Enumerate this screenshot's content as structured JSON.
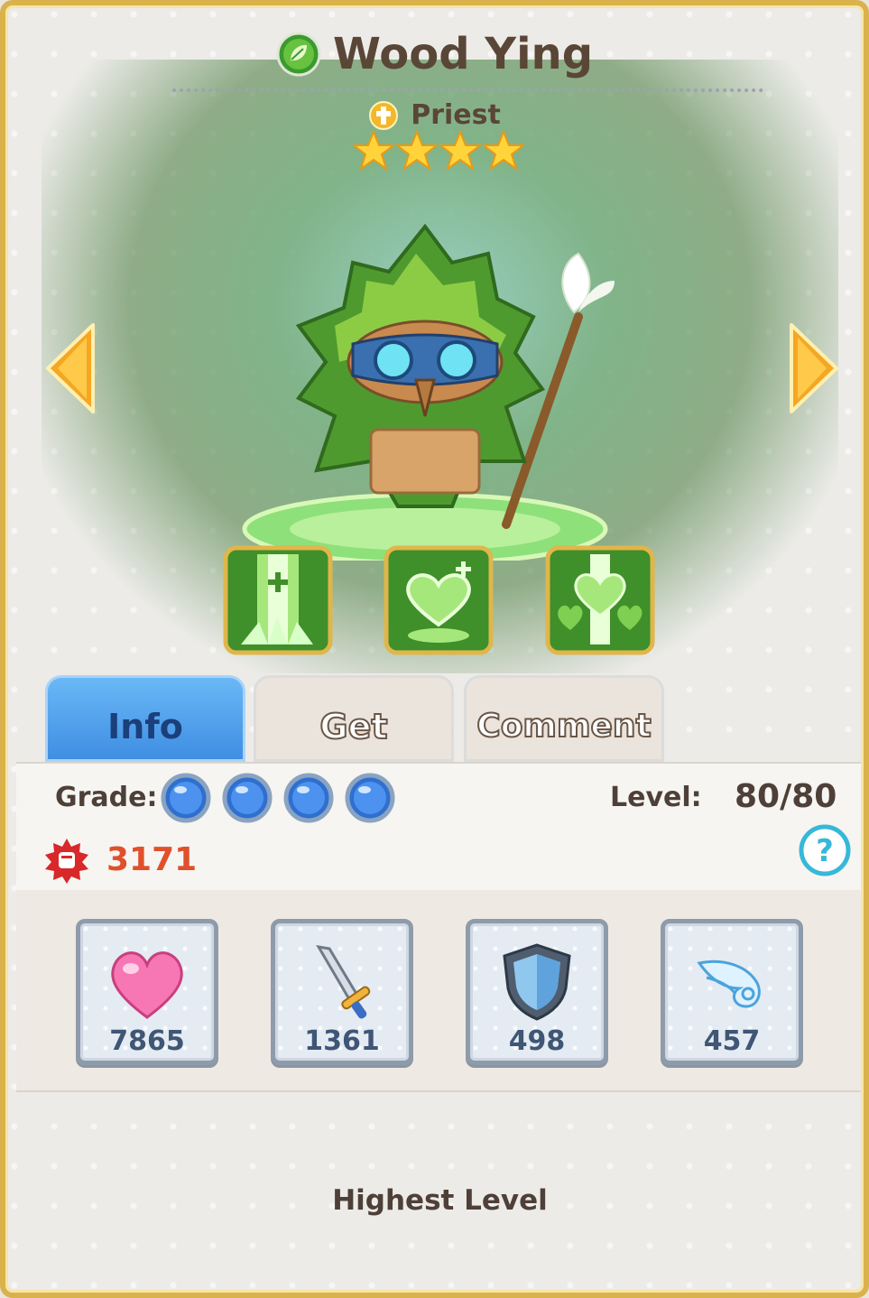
{
  "hero": {
    "name": "Wood Ying",
    "element_icon": "leaf-element-icon",
    "class": "Priest",
    "class_icon": "priest-cross-icon",
    "stars": 4
  },
  "skills": [
    {
      "icon": "healing-pillar-icon"
    },
    {
      "icon": "heart-heal-icon"
    },
    {
      "icon": "multi-heart-heal-icon"
    }
  ],
  "tabs": {
    "info": "Info",
    "get": "Get",
    "comment": "Comment",
    "active": "info"
  },
  "info": {
    "grade_label": "Grade:",
    "grade_orbs": 4,
    "level_label": "Level:",
    "level_value": "80/80",
    "power_value": "3171"
  },
  "stats": {
    "hp": "7865",
    "attack": "1361",
    "defense": "498",
    "speed": "457"
  },
  "footer": {
    "message": "Highest Level"
  },
  "colors": {
    "frame_gold": "#d9b24c",
    "active_tab": "#4a9aea",
    "power_red": "#e0502a",
    "text_brown": "#4e4038"
  }
}
